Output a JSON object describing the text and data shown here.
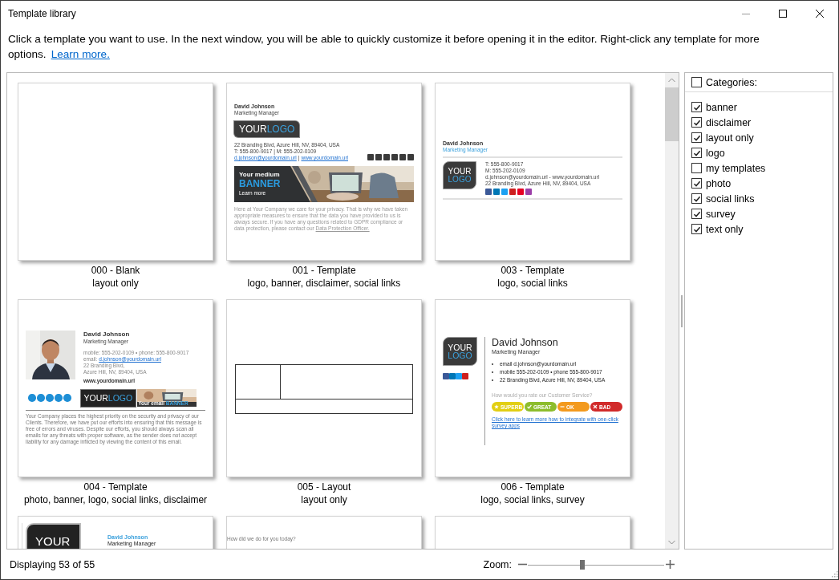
{
  "window": {
    "title": "Template library"
  },
  "description": {
    "text": "Click a template you want to use. In the next window, you will be able to quickly customize it before opening it in the editor. Right-click any template for more options.",
    "link": "Learn more."
  },
  "templates": [
    {
      "name": "000 - Blank",
      "tags": "layout only",
      "preview": {
        "kind": "blank"
      }
    },
    {
      "name": "001 - Template",
      "tags": "logo, banner, disclaimer, social links",
      "preview": {
        "kind": "banner_signature",
        "person": "David Johnson",
        "role": "Marketing Manager",
        "logo": [
          "YOUR",
          "LOGO"
        ],
        "lines": [
          "22 Branding Blvd, Azure Hill, NV, 89404, USA",
          "T: 555-800-9017 | M: 555-202-0109"
        ],
        "email": "d.johnson@yourdomain.url",
        "separator": "|",
        "website": "www.yourdomain.url",
        "social_icons": [
          {
            "color": "#3a3a3a"
          },
          {
            "color": "#3a3a3a"
          },
          {
            "color": "#3a3a3a"
          },
          {
            "color": "#3a3a3a"
          },
          {
            "color": "#3a3a3a"
          },
          {
            "color": "#3a3a3a"
          }
        ],
        "banner": {
          "headline": "Your medium",
          "title": "BANNER",
          "cta": "Learn more"
        },
        "disclaimer": "Here at Your Company we care for your privacy. That is why we have taken appropriate measures to ensure that the data you have provided to us is always secure. If you have any questions related to GDPR compliance or data protection, please contact our",
        "disclaimer_link": "Data Protection Officer."
      }
    },
    {
      "name": "003 - Template",
      "tags": "logo, social links",
      "preview": {
        "kind": "compact_signature",
        "person": "David Johnson",
        "role": "Marketing Manager",
        "logo": [
          "YOUR",
          "LOGO"
        ],
        "lines": [
          "T: 555-800-9017",
          "M: 555-202-0109",
          "d.johnson@yourdomain.url - www.yourdomain.url",
          "22 Branding Blvd, Azure Hill, NV, 89404, USA"
        ],
        "social_icons": [
          {
            "color": "#3b5998"
          },
          {
            "color": "#0077b5"
          },
          {
            "color": "#1da1f2"
          },
          {
            "color": "#cd201f"
          },
          {
            "color": "#e60023"
          },
          {
            "color": "#9b3fa8"
          }
        ]
      }
    },
    {
      "name": "004 - Template",
      "tags": "photo, banner, logo, social links, disclaimer",
      "preview": {
        "kind": "photo_signature",
        "person": "David Johnson",
        "role": "Marketing Manager",
        "lines": [
          "mobile: 555-202-0109 • phone: 555-800-9017"
        ],
        "email_label": "email:",
        "email": "d.johnson@yourdomain.url",
        "address": [
          "22 Branding Blvd,",
          "Azure Hill, NV, 89404, USA"
        ],
        "website": "www.yourdomain.url",
        "logo": [
          "YOUR",
          "LOGO"
        ],
        "social_icons": [
          {
            "color": "#1e8fd6"
          },
          {
            "color": "#1e8fd6"
          },
          {
            "color": "#1e8fd6"
          },
          {
            "color": "#1e8fd6"
          },
          {
            "color": "#1e8fd6"
          }
        ],
        "banner": {
          "headline": "Your email",
          "title": "BANNER"
        },
        "disclaimer": "Your Company places the highest priority on the security and privacy of our Clients. Therefore, we have put our efforts into ensuring that this message is free of errors and viruses. Despite our efforts, you should always scan all emails for any threats with proper software, as the sender does not accept liability for any damage inflicted by viewing the content of this email."
      }
    },
    {
      "name": "005 - Layout",
      "tags": "layout only",
      "preview": {
        "kind": "layout"
      }
    },
    {
      "name": "006 - Template",
      "tags": "logo, social links, survey",
      "preview": {
        "kind": "survey_signature",
        "person": "David Johnson",
        "role": "Marketing Manager",
        "logo": [
          "YOUR",
          "LOGO"
        ],
        "bullets": [
          "email d.johnson@yourdomain.url",
          "mobile 555-202-0109 • phone 555-800-9017",
          "22 Branding Blvd, Azure Hill, NV, 89404, USA"
        ],
        "question": "How would you rate our Customer Service?",
        "social_icons": [
          {
            "color": "#3b5998"
          },
          {
            "color": "#0077b5"
          },
          {
            "color": "#1da1f2"
          },
          {
            "color": "#cd201f"
          }
        ],
        "ratings": [
          {
            "label": "SUPERB",
            "kind": "star",
            "color": "#e2cf14"
          },
          {
            "label": "GREAT",
            "kind": "check",
            "color": "#8dbd2c"
          },
          {
            "label": "OK",
            "kind": "dash",
            "color": "#f39a1e"
          },
          {
            "label": "BAD",
            "kind": "cross",
            "color": "#d12b2b"
          }
        ],
        "link": "Click here to learn more how to integrate with one-click survey apps"
      }
    },
    {
      "preview": {
        "kind": "logo_top",
        "person": "David Johnson",
        "role": "Marketing Manager",
        "logo": [
          "YOUR"
        ]
      }
    },
    {
      "preview": {
        "kind": "question_top",
        "question": "How did we do for you today?"
      }
    },
    {
      "preview": {
        "kind": "blank"
      }
    }
  ],
  "categories": {
    "label": "Categories:",
    "checked": false,
    "items": [
      {
        "label": "banner",
        "checked": true
      },
      {
        "label": "disclaimer",
        "checked": true
      },
      {
        "label": "layout only",
        "checked": true
      },
      {
        "label": "logo",
        "checked": true
      },
      {
        "label": "my templates",
        "checked": false
      },
      {
        "label": "photo",
        "checked": true
      },
      {
        "label": "social links",
        "checked": true
      },
      {
        "label": "survey",
        "checked": true
      },
      {
        "label": "text only",
        "checked": true
      }
    ]
  },
  "status_bar": {
    "count": "Displaying 53 of 55",
    "zoom_label": "Zoom:",
    "zoom": {
      "level": 0.4
    }
  }
}
